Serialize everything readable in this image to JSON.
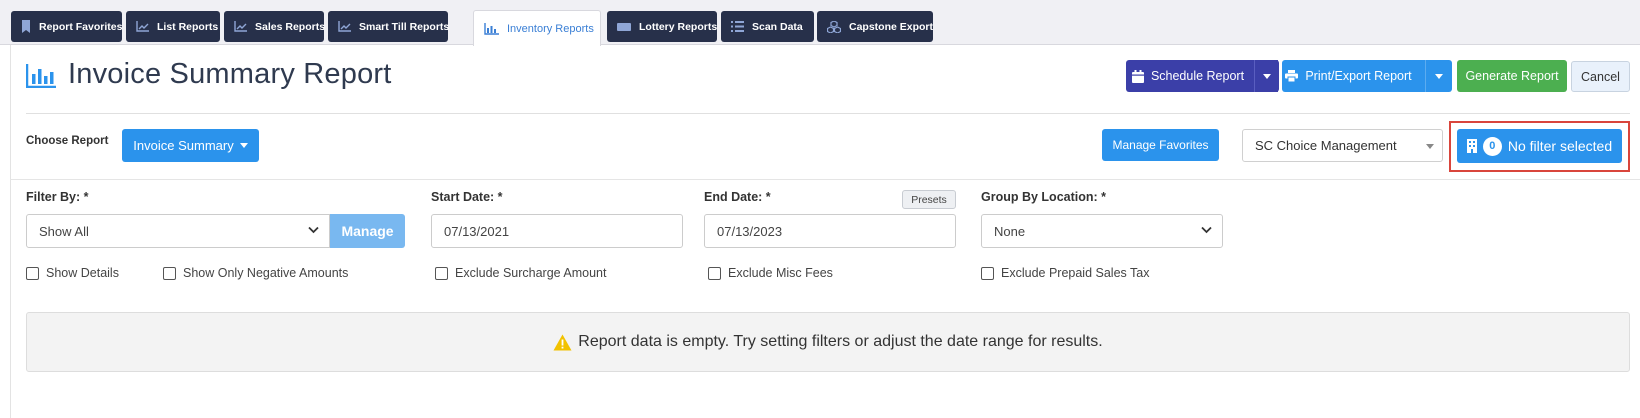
{
  "tabs": [
    {
      "label": "Report Favorites",
      "icon": "bookmark-icon",
      "active": false
    },
    {
      "label": "List Reports",
      "icon": "line-chart-icon",
      "active": false
    },
    {
      "label": "Sales Reports",
      "icon": "line-chart-icon",
      "active": false
    },
    {
      "label": "Smart Till Reports",
      "icon": "line-chart-icon",
      "active": false
    },
    {
      "label": "Inventory Reports",
      "icon": "inventory-chart-icon",
      "active": true
    },
    {
      "label": "Lottery Reports",
      "icon": "ticket-icon",
      "active": false
    },
    {
      "label": "Scan Data",
      "icon": "list-icon",
      "active": false
    },
    {
      "label": "Capstone Export",
      "icon": "cubes-icon",
      "active": false
    }
  ],
  "header": {
    "title": "Invoice Summary Report",
    "schedule_label": "Schedule Report",
    "print_label": "Print/Export Report",
    "generate_label": "Generate Report",
    "cancel_label": "Cancel"
  },
  "choose": {
    "label": "Choose Report",
    "report_value": "Invoice Summary",
    "favorites_label": "Manage Favorites",
    "company_value": "SC Choice Management",
    "filter_count": "0",
    "filter_label": "No filter selected"
  },
  "filters": {
    "filter_by_label": "Filter By: *",
    "filter_by_value": "Show All",
    "manage_label": "Manage",
    "start_label": "Start Date: *",
    "start_value": "07/13/2021",
    "end_label": "End Date: *",
    "end_value": "07/13/2023",
    "presets_label": "Presets",
    "group_label": "Group By Location: *",
    "group_value": "None"
  },
  "checkboxes": {
    "show_details": "Show Details",
    "negative_only": "Show Only Negative Amounts",
    "exclude_surcharge": "Exclude Surcharge Amount",
    "exclude_misc": "Exclude Misc Fees",
    "exclude_prepaid": "Exclude Prepaid Sales Tax"
  },
  "message": {
    "empty_text": "Report data is empty. Try setting filters or adjust the date range for results."
  },
  "colors": {
    "nav_dark": "#27304a",
    "primary_blue": "#2b93ec",
    "schedule_indigo": "#3b3fa8",
    "generate_green": "#4caf50",
    "highlight_red": "#d9453c",
    "warning_yellow": "#f2c200"
  }
}
